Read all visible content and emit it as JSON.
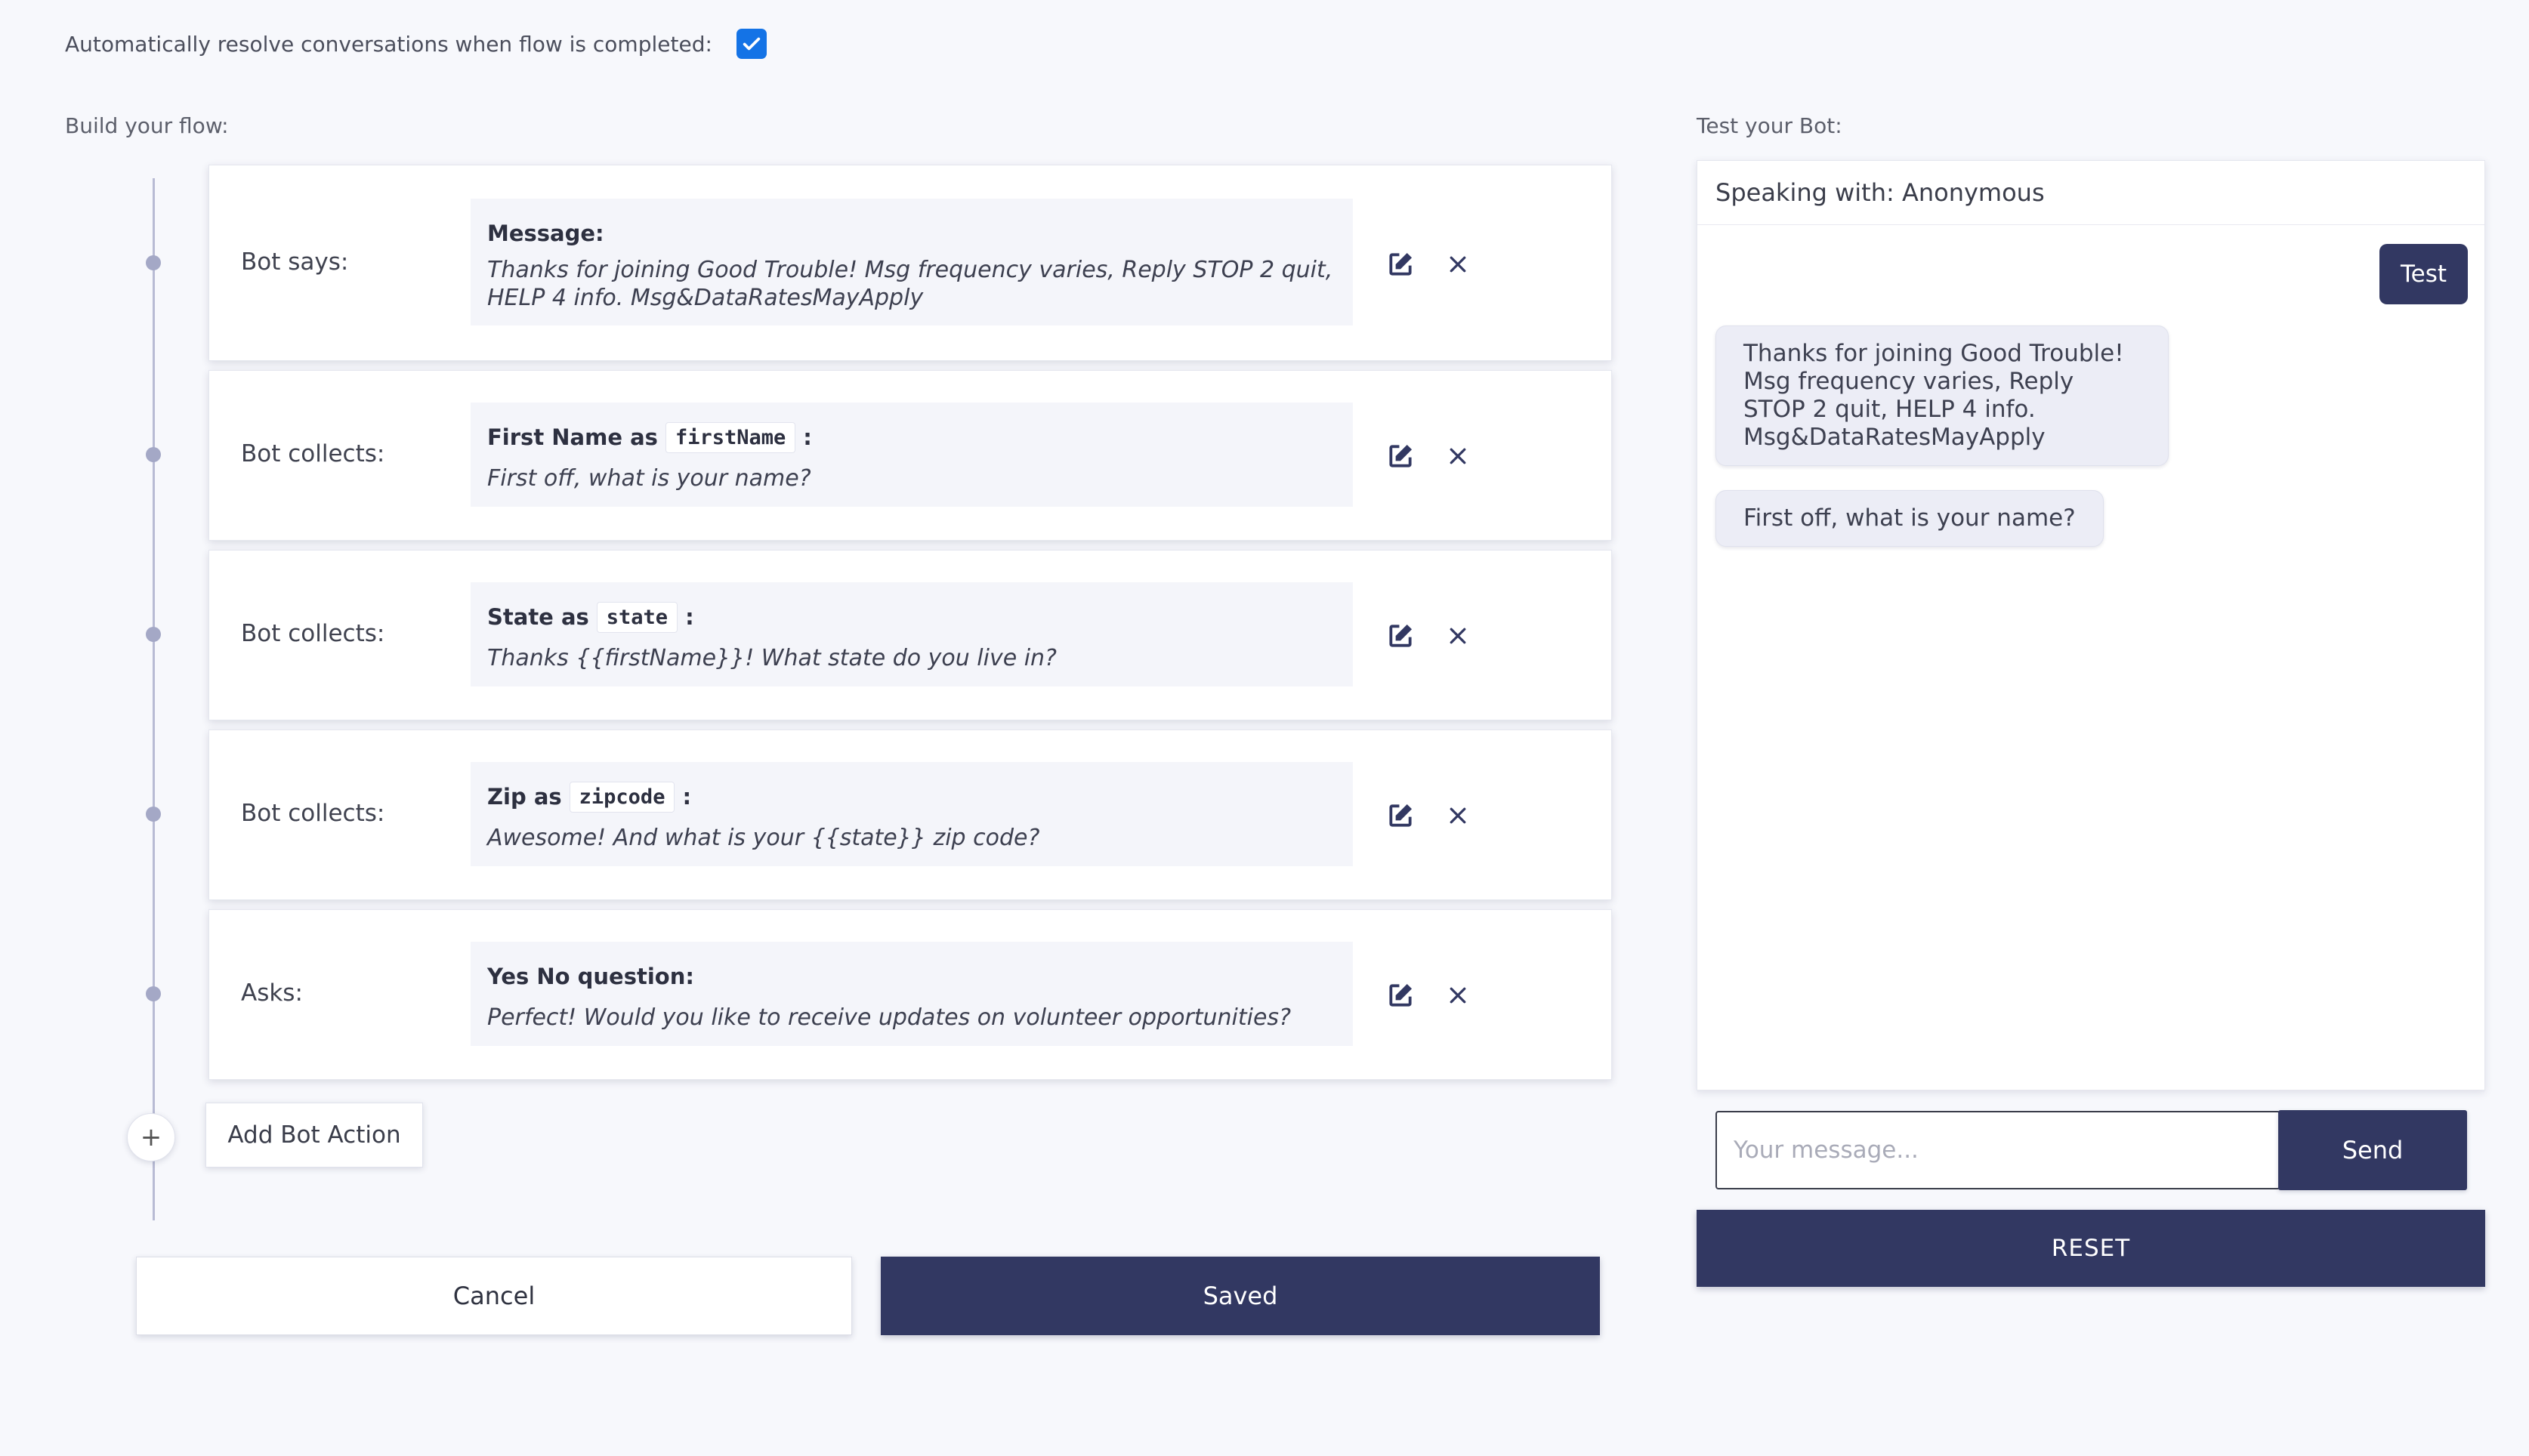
{
  "settings": {
    "auto_resolve_label": "Automatically resolve conversations when flow is completed:",
    "auto_resolve_checked": true
  },
  "flow": {
    "section_label": "Build your flow:",
    "steps": [
      {
        "label": "Bot says:",
        "title": "Message:",
        "variable": "",
        "title_suffix": "",
        "text": "Thanks for joining Good Trouble! Msg frequency varies, Reply STOP 2 quit, HELP 4 info. Msg&DataRatesMayApply"
      },
      {
        "label": "Bot collects:",
        "title": "First Name as",
        "variable": "firstName",
        "title_suffix": ":",
        "text": "First off, what is your name?"
      },
      {
        "label": "Bot collects:",
        "title": "State as",
        "variable": "state",
        "title_suffix": ":",
        "text": "Thanks {{firstName}}! What state do you live in?"
      },
      {
        "label": "Bot collects:",
        "title": "Zip as",
        "variable": "zipcode",
        "title_suffix": ":",
        "text": "Awesome! And what is your {{state}} zip code?"
      },
      {
        "label": "Asks:",
        "title": "Yes No question:",
        "variable": "",
        "title_suffix": "",
        "text": "Perfect! Would you like to receive updates on volunteer opportunities?"
      }
    ],
    "add_icon": "+",
    "add_label": "Add Bot Action",
    "cancel_label": "Cancel",
    "save_label": "Saved"
  },
  "test_bot": {
    "section_label": "Test your Bot:",
    "header": "Speaking with: Anonymous",
    "messages": [
      {
        "from": "user",
        "text": "Test"
      },
      {
        "from": "bot",
        "text": "Thanks for joining Good Trouble! Msg frequency varies, Reply STOP 2 quit, HELP 4 info. Msg&DataRatesMayApply"
      },
      {
        "from": "bot",
        "text": "First off, what is your name?"
      }
    ],
    "input_placeholder": "Your message...",
    "send_label": "Send",
    "reset_label": "RESET"
  },
  "icons": {
    "edit": "edit-icon",
    "close": "close-icon",
    "check": "check-icon",
    "add": "plus-icon"
  },
  "colors": {
    "primary": "#323862",
    "checkbox": "#1473e6",
    "background": "#f7f8fc",
    "timeline": "#b8bbd4"
  }
}
